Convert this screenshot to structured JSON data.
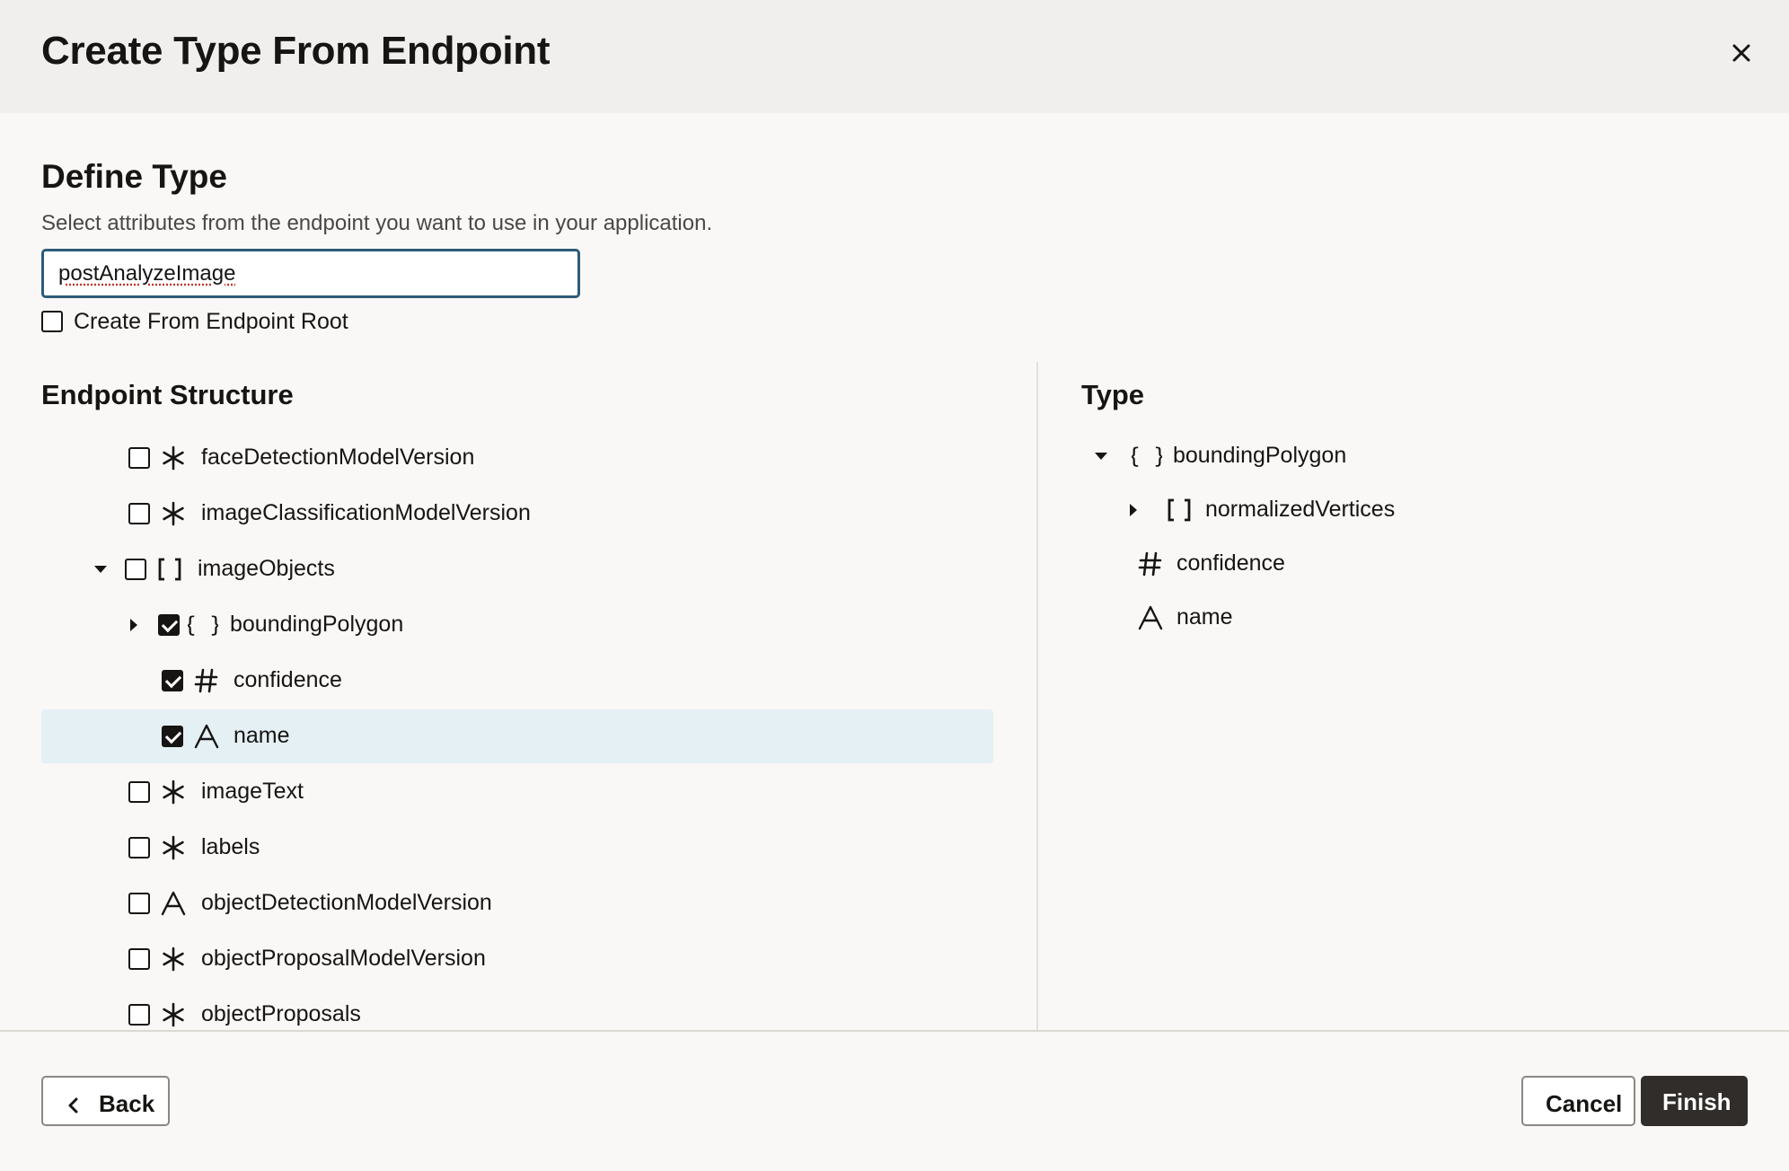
{
  "dialog": {
    "title": "Create Type From Endpoint"
  },
  "define": {
    "title": "Define Type",
    "description": "Select attributes from the endpoint you want to use in your application.",
    "type_name_value": "postAnalyzeImage",
    "root_checkbox_label": "Create From Endpoint Root",
    "root_checkbox_checked": false
  },
  "structure": {
    "title": "Endpoint Structure",
    "rows": [
      {
        "label": "faceDetectionModelVersion",
        "icon": "any-type-icon",
        "checked": false,
        "toggle": "none",
        "selected": false
      },
      {
        "label": "imageClassificationModelVersion",
        "icon": "any-type-icon",
        "checked": false,
        "toggle": "none",
        "selected": false
      },
      {
        "label": "imageObjects",
        "icon": "array-icon",
        "checked": false,
        "toggle": "expanded",
        "selected": false
      },
      {
        "label": "boundingPolygon",
        "icon": "object-icon",
        "checked": true,
        "toggle": "collapsed",
        "selected": false
      },
      {
        "label": "confidence",
        "icon": "number-icon",
        "checked": true,
        "toggle": "none",
        "selected": false
      },
      {
        "label": "name",
        "icon": "string-icon",
        "checked": true,
        "toggle": "none",
        "selected": true
      },
      {
        "label": "imageText",
        "icon": "any-type-icon",
        "checked": false,
        "toggle": "none",
        "selected": false
      },
      {
        "label": "labels",
        "icon": "any-type-icon",
        "checked": false,
        "toggle": "none",
        "selected": false
      },
      {
        "label": "objectDetectionModelVersion",
        "icon": "string-icon",
        "checked": false,
        "toggle": "none",
        "selected": false
      },
      {
        "label": "objectProposalModelVersion",
        "icon": "any-type-icon",
        "checked": false,
        "toggle": "none",
        "selected": false
      },
      {
        "label": "objectProposals",
        "icon": "any-type-icon",
        "checked": false,
        "toggle": "none",
        "selected": false
      }
    ]
  },
  "type_panel": {
    "title": "Type",
    "rows": [
      {
        "label": "boundingPolygon",
        "icon": "object-icon",
        "toggle": "expanded"
      },
      {
        "label": "normalizedVertices",
        "icon": "array-icon",
        "toggle": "collapsed"
      },
      {
        "label": "confidence",
        "icon": "number-icon",
        "toggle": "none"
      },
      {
        "label": "name",
        "icon": "string-icon",
        "toggle": "none"
      }
    ]
  },
  "footer": {
    "back_label": "Back",
    "cancel_label": "Cancel",
    "finish_label": "Finish"
  }
}
